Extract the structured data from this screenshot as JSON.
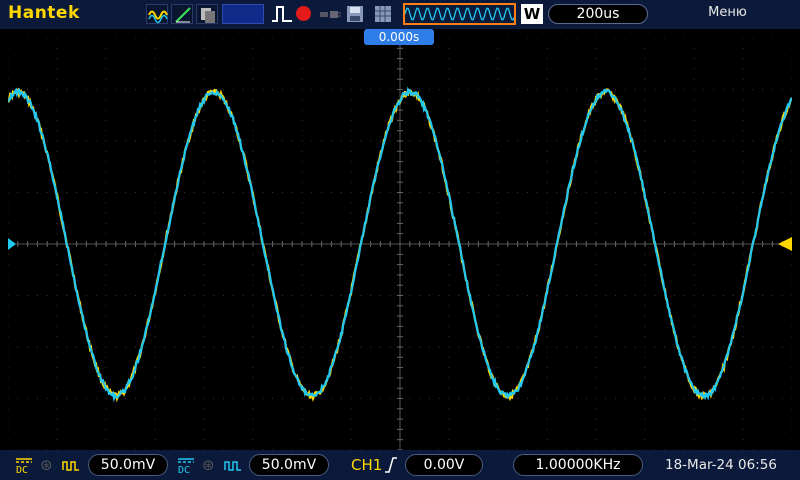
{
  "topbar": {
    "brand": "Hantek",
    "acq_mode": "W",
    "timebase": "200us",
    "menu_label": "Меню",
    "icons": [
      "waveform-icon",
      "ramp-icon",
      "layers-icon",
      "pulse-icon",
      "record-icon",
      "plug-icon",
      "save-icon",
      "grid-icon"
    ]
  },
  "screen": {
    "trigger_position_label": "0.000s",
    "grid_divisions": {
      "horizontal": 16,
      "vertical": 8
    },
    "ch1_color": "#ffd800",
    "ch2_color": "#22c8f2",
    "trigger_marker_color": "#ffd800",
    "ch1_marker_color": "#22c8f2"
  },
  "bottombar": {
    "ch1": {
      "coupling": "DC",
      "volts_div": "50.0mV",
      "color": "#ffd800"
    },
    "ch2": {
      "coupling": "DC",
      "volts_div": "50.0mV",
      "color": "#22c8f2"
    },
    "trigger": {
      "source": "CH1",
      "level": "0.00V"
    },
    "frequency": "1.00000KHz",
    "datetime": "18-Mar-24 06:56"
  }
}
